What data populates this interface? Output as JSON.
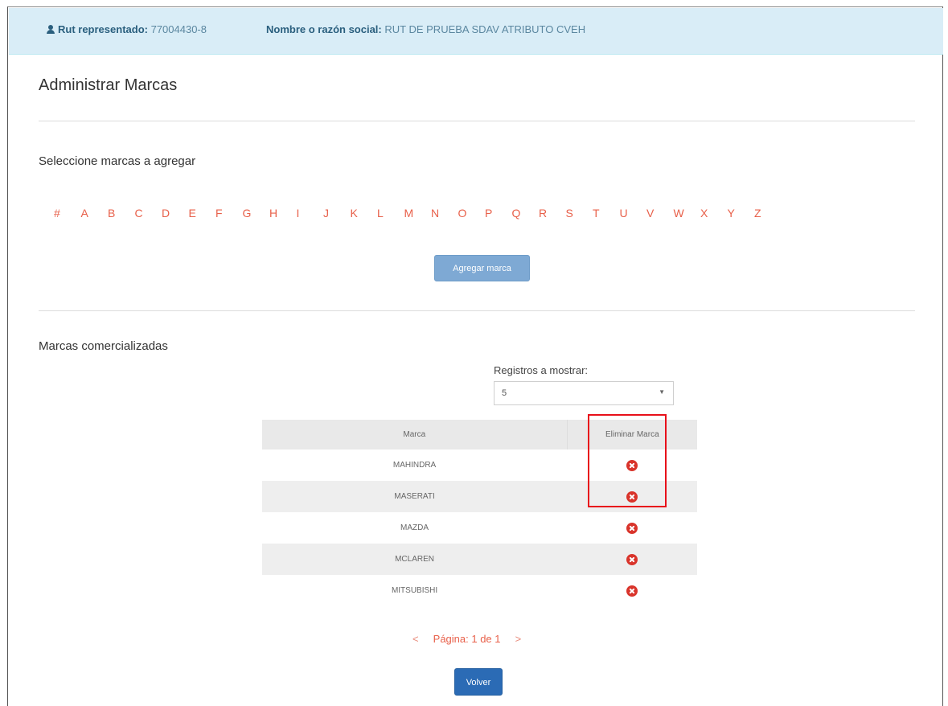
{
  "info": {
    "rut_label": "Rut representado:",
    "rut_value": "77004430-8",
    "name_label": "Nombre o razón social:",
    "name_value": "RUT DE PRUEBA SDAV ATRIBUTO CVEH"
  },
  "page": {
    "title": "Administrar Marcas",
    "select_brands_label": "Seleccione marcas a agregar",
    "commercialized_label": "Marcas comercializadas"
  },
  "letters": [
    "#",
    "A",
    "B",
    "C",
    "D",
    "E",
    "F",
    "G",
    "H",
    "I",
    "J",
    "K",
    "L",
    "M",
    "N",
    "O",
    "P",
    "Q",
    "R",
    "S",
    "T",
    "U",
    "V",
    "W",
    "X",
    "Y",
    "Z"
  ],
  "buttons": {
    "add_brand": "Agregar marca",
    "back": "Volver"
  },
  "records_select": {
    "label": "Registros a mostrar:",
    "value": "5"
  },
  "table": {
    "headers": [
      "Marca",
      "Eliminar Marca"
    ],
    "rows": [
      "MAHINDRA",
      "MASERATI",
      "MAZDA",
      "MCLAREN",
      "MITSUBISHI"
    ]
  },
  "pagination": {
    "prev": "<",
    "text": "Página: 1 de 1",
    "next": ">"
  },
  "colors": {
    "info_bg": "#d9edf7",
    "letter_color": "#e8604a",
    "delete_icon": "#d9342b",
    "highlight_border": "#e8101a",
    "primary_button": "#2b6bb5"
  }
}
